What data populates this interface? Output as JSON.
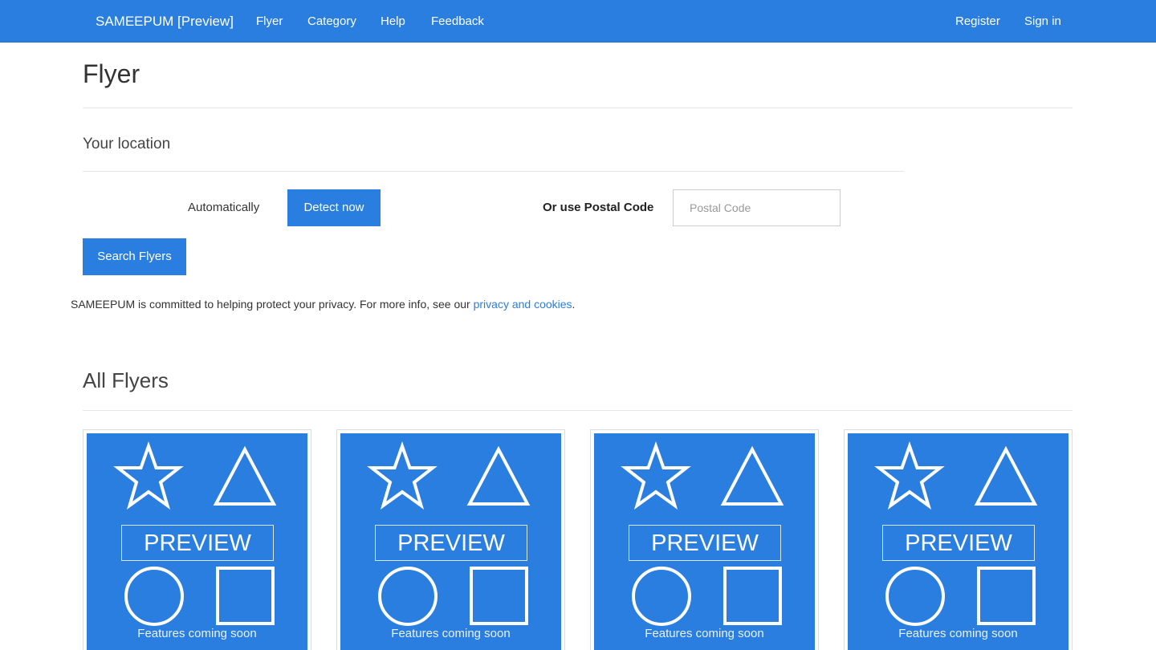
{
  "nav": {
    "brand": "SAMEEPUM [Preview]",
    "items": [
      "Flyer",
      "Category",
      "Help",
      "Feedback"
    ],
    "register": "Register",
    "signin": "Sign in"
  },
  "page": {
    "title": "Flyer",
    "location_title": "Your location",
    "automatically_label": "Automatically",
    "detect_button": "Detect now",
    "postal_label": "Or use Postal Code",
    "postal_placeholder": "Postal Code",
    "search_button": "Search Flyers",
    "privacy_text": "SAMEEPUM is committed to helping protect your privacy. For more info, see our ",
    "privacy_link": "privacy and cookies",
    "privacy_end": ".",
    "all_flyers_title": "All Flyers"
  },
  "flyers": [
    {
      "preview": "PREVIEW",
      "caption": "Features coming soon"
    },
    {
      "preview": "PREVIEW",
      "caption": "Features coming soon"
    },
    {
      "preview": "PREVIEW",
      "caption": "Features coming soon"
    },
    {
      "preview": "PREVIEW",
      "caption": "Features coming soon"
    }
  ],
  "colors": {
    "accent": "#2a7ee0",
    "link": "#2a7ee0"
  }
}
